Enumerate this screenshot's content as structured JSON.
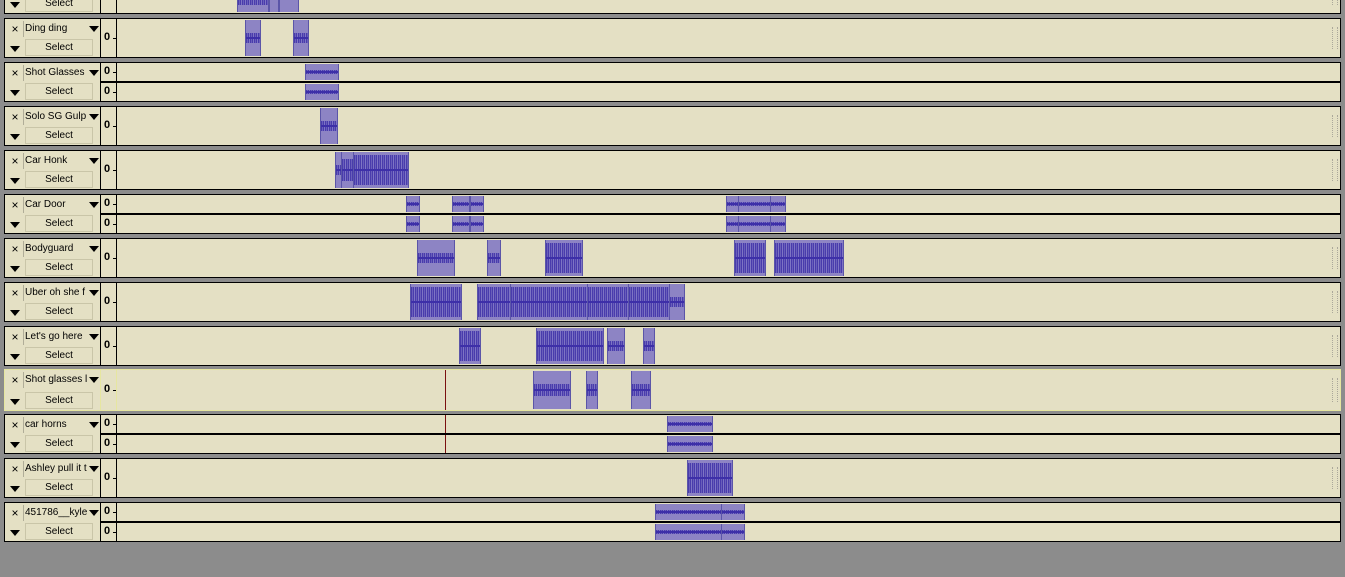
{
  "controls": {
    "close": "×",
    "select": "Select",
    "db_zero": "0"
  },
  "colors": {
    "background": "#8c8c8c",
    "track": "#e4e0c4",
    "clip": "#8d84c4",
    "waveform": "#3d2fa8",
    "selected_border": "#ffff00",
    "edit_cursor": "#7a1010"
  },
  "tracks": [
    {
      "name": "",
      "channels": 1,
      "selected": false
    },
    {
      "name": "Ding ding",
      "channels": 1,
      "selected": false
    },
    {
      "name": "Shot Glasses",
      "channels": 2,
      "selected": false
    },
    {
      "name": "Solo SG Gulp",
      "channels": 1,
      "selected": false
    },
    {
      "name": "Car Honk",
      "channels": 1,
      "selected": false
    },
    {
      "name": "Car Door",
      "channels": 2,
      "selected": false
    },
    {
      "name": "Bodyguard",
      "channels": 1,
      "selected": false
    },
    {
      "name": "Uber oh she f",
      "channels": 1,
      "selected": false
    },
    {
      "name": "Let's go here",
      "channels": 1,
      "selected": false
    },
    {
      "name": "Shot glasses l",
      "channels": 1,
      "selected": true
    },
    {
      "name": "car horns",
      "channels": 2,
      "selected": false
    },
    {
      "name": "Ashley pull it t",
      "channels": 1,
      "selected": false
    },
    {
      "name": "451786__kyle",
      "channels": 2,
      "selected": false
    }
  ]
}
